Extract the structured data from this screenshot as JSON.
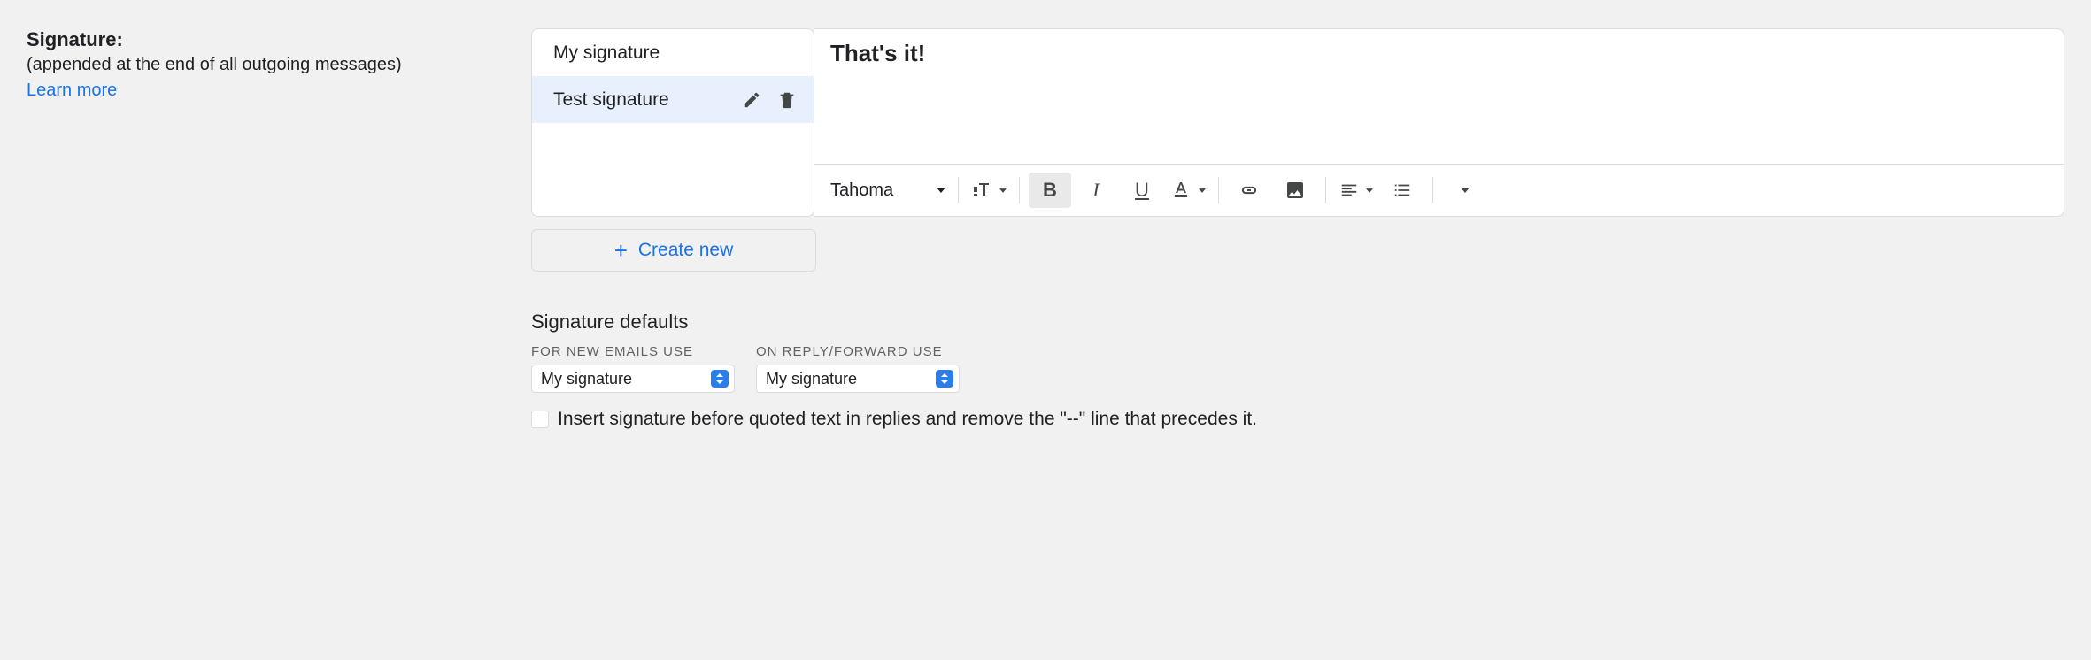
{
  "setting": {
    "title": "Signature:",
    "subtitle": "(appended at the end of all outgoing messages)",
    "learn_more": "Learn more"
  },
  "signatures": {
    "items": [
      {
        "label": "My signature",
        "selected": false
      },
      {
        "label": "Test signature",
        "selected": true
      }
    ]
  },
  "editor": {
    "content": "That's it!"
  },
  "create_new": "Create new",
  "toolbar": {
    "font": "Tahoma"
  },
  "defaults": {
    "heading": "Signature defaults",
    "new_label": "FOR NEW EMAILS USE",
    "reply_label": "ON REPLY/FORWARD USE",
    "new_value": "My signature",
    "reply_value": "My signature",
    "insert_before": "Insert signature before quoted text in replies and remove the \"--\" line that precedes it."
  }
}
